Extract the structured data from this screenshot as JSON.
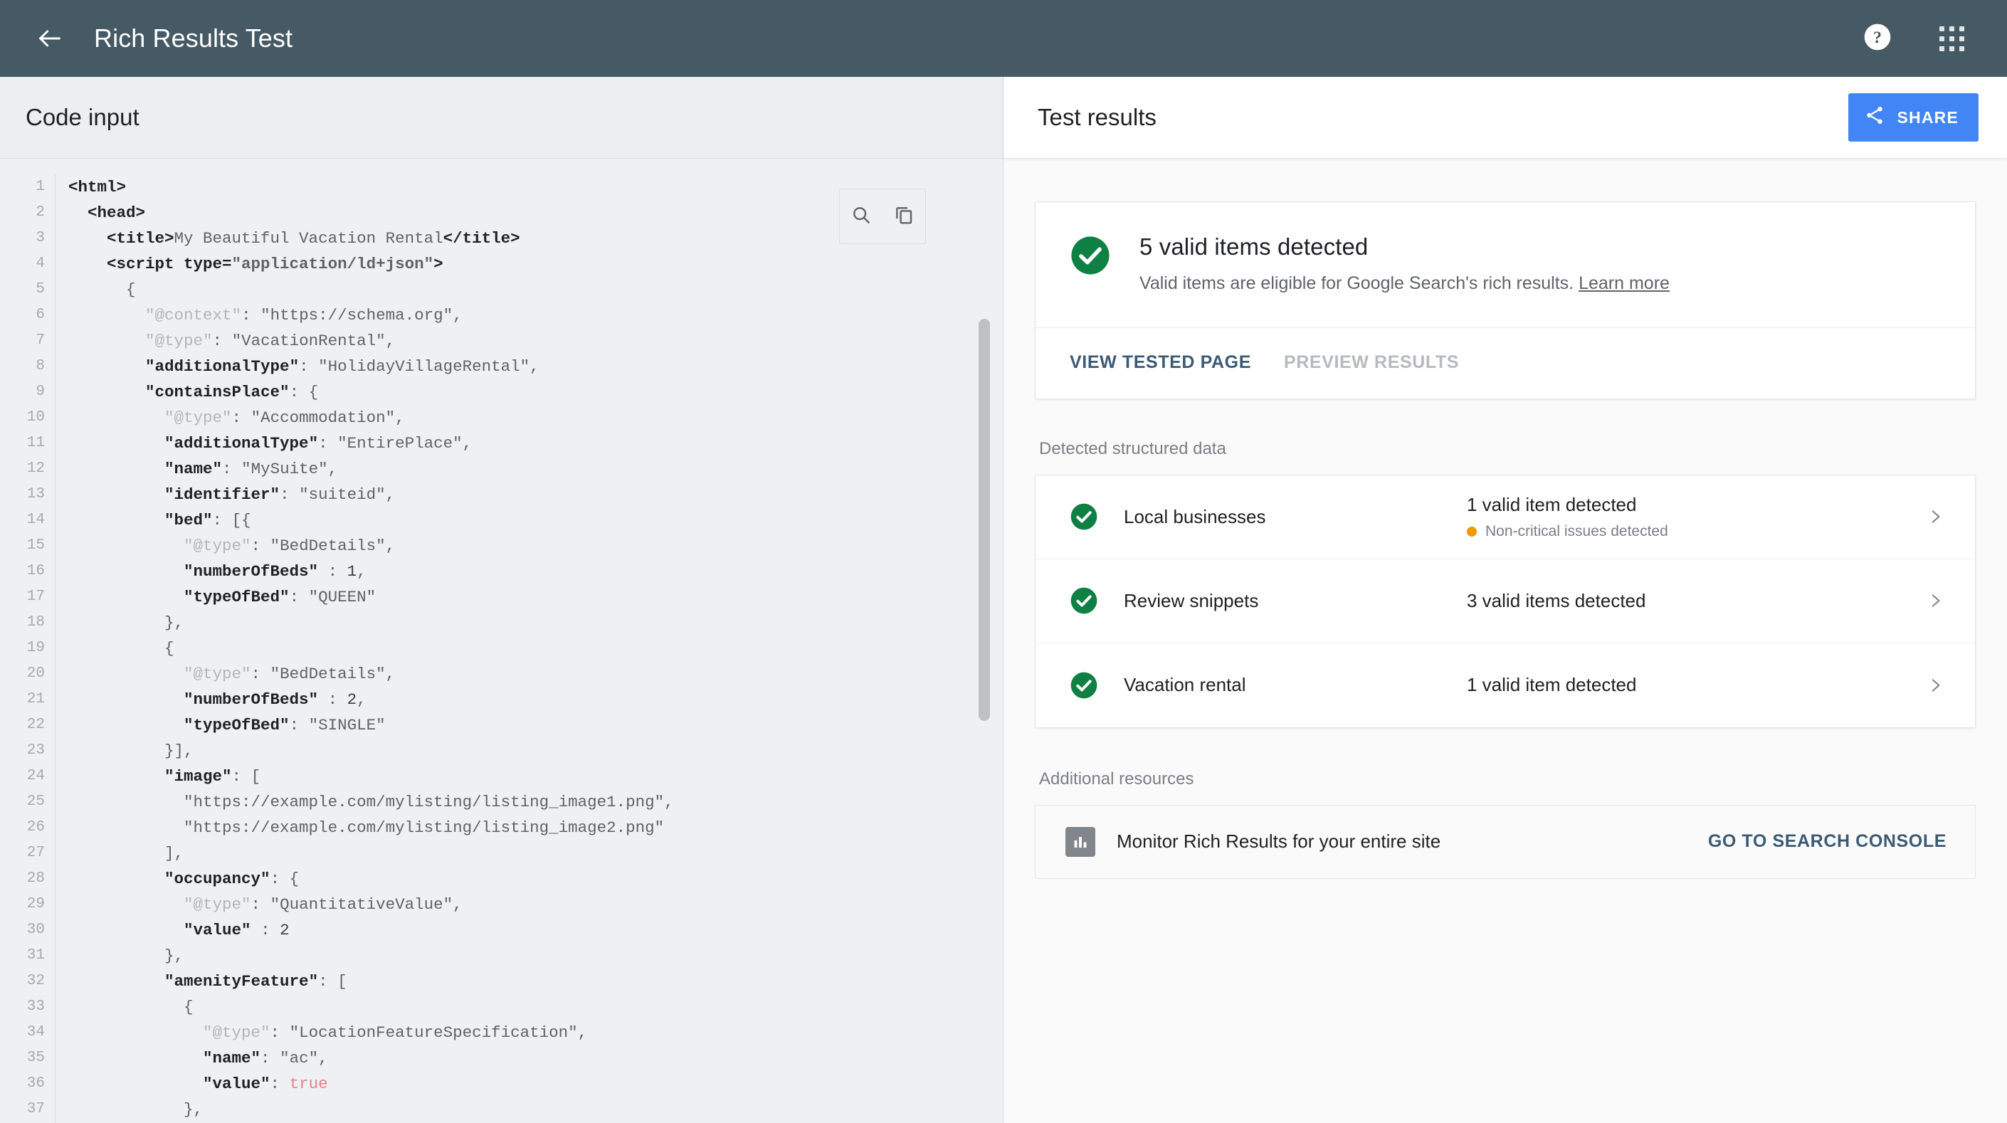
{
  "appbar": {
    "back_icon": "arrow-left-icon",
    "title": "Rich Results Test",
    "help_icon": "help-icon",
    "apps_icon": "apps-grid-icon"
  },
  "code_panel": {
    "title": "Code input",
    "tools": {
      "search_icon": "search-icon",
      "copy_icon": "copy-icon"
    },
    "line_numbers": [
      1,
      2,
      3,
      4,
      5,
      6,
      7,
      8,
      9,
      10,
      11,
      12,
      13,
      14,
      15,
      16,
      17,
      18,
      19,
      20,
      21,
      22,
      23,
      24,
      25,
      26,
      27,
      28,
      29,
      30,
      31,
      32,
      33,
      34,
      35,
      36,
      37
    ],
    "lines": [
      "<html>",
      "  <head>",
      "    <title>My Beautiful Vacation Rental</title>",
      "    <script type=\"application/ld+json\">",
      "      {",
      "        \"@context\": \"https://schema.org\",",
      "        \"@type\": \"VacationRental\",",
      "        \"additionalType\": \"HolidayVillageRental\",",
      "        \"containsPlace\": {",
      "          \"@type\": \"Accommodation\",",
      "          \"additionalType\": \"EntirePlace\",",
      "          \"name\": \"MySuite\",",
      "          \"identifier\": \"suiteid\",",
      "          \"bed\": [{",
      "            \"@type\": \"BedDetails\",",
      "            \"numberOfBeds\" : 1,",
      "            \"typeOfBed\": \"QUEEN\"",
      "          },",
      "          {",
      "            \"@type\": \"BedDetails\",",
      "            \"numberOfBeds\" : 2,",
      "            \"typeOfBed\": \"SINGLE\"",
      "          }],",
      "          \"image\": [",
      "            \"https://example.com/mylisting/listing_image1.png\",",
      "            \"https://example.com/mylisting/listing_image2.png\"",
      "          ],",
      "          \"occupancy\": {",
      "            \"@type\": \"QuantitativeValue\",",
      "            \"value\" : 2",
      "          },",
      "          \"amenityFeature\": [",
      "            {",
      "              \"@type\": \"LocationFeatureSpecification\",",
      "              \"name\": \"ac\",",
      "              \"value\": true",
      "            },"
    ]
  },
  "results_panel": {
    "title": "Test results",
    "share_label": "SHARE",
    "share_icon": "share-icon",
    "summary": {
      "status_icon": "check-circle-icon",
      "headline": "5 valid items detected",
      "description": "Valid items are eligible for Google Search's rich results.",
      "learn_more": "Learn more",
      "primary_action": "VIEW TESTED PAGE",
      "secondary_action": "PREVIEW RESULTS"
    },
    "detected_section_label": "Detected structured data",
    "detected_items": [
      {
        "status_icon": "check-circle-icon",
        "name": "Local businesses",
        "status": "1 valid item detected",
        "sub_status": "Non-critical issues detected",
        "sub_status_color": "#f29900",
        "chevron_icon": "chevron-right-icon"
      },
      {
        "status_icon": "check-circle-icon",
        "name": "Review snippets",
        "status": "3 valid items detected",
        "sub_status": "",
        "chevron_icon": "chevron-right-icon"
      },
      {
        "status_icon": "check-circle-icon",
        "name": "Vacation rental",
        "status": "1 valid item detected",
        "sub_status": "",
        "chevron_icon": "chevron-right-icon"
      }
    ],
    "resources_section_label": "Additional resources",
    "resource": {
      "icon": "bar-chart-icon",
      "text": "Monitor Rich Results for your entire site",
      "action": "GO TO SEARCH CONSOLE"
    }
  },
  "colors": {
    "appbar_bg": "#455a64",
    "share_blue": "#4285f4",
    "valid_green": "#0f8043",
    "warning_orange": "#f29900",
    "link_slate": "#3c5a73"
  }
}
